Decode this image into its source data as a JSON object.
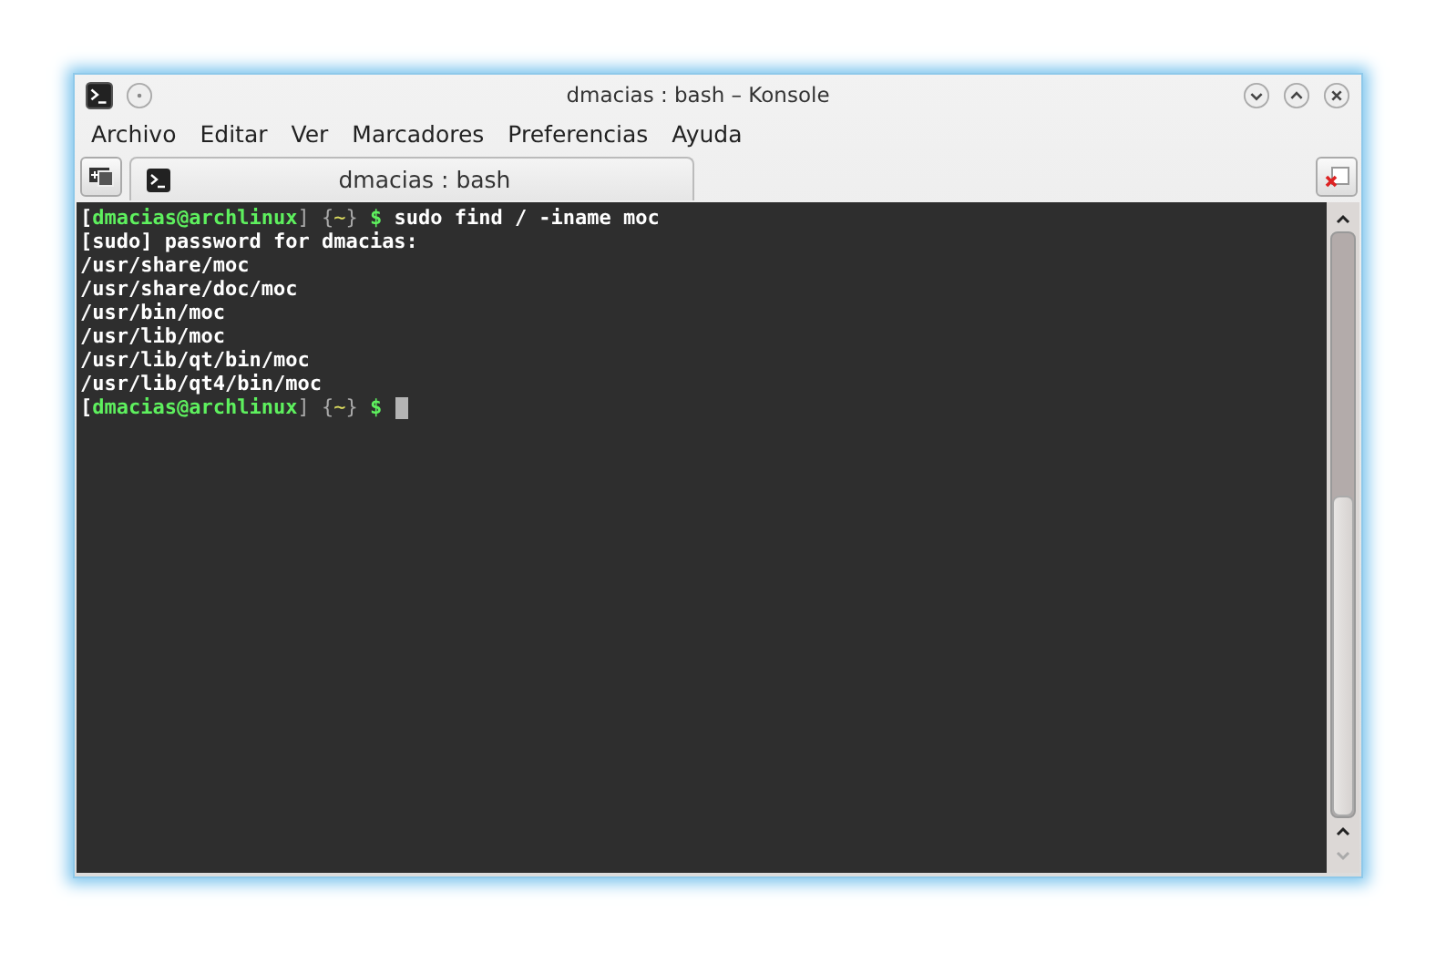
{
  "window": {
    "title": "dmacias : bash – Konsole"
  },
  "menu": [
    "Archivo",
    "Editar",
    "Ver",
    "Marcadores",
    "Preferencias",
    "Ayuda"
  ],
  "tabs": [
    {
      "label": "dmacias : bash",
      "selected": true
    }
  ],
  "terminal": {
    "lines": [
      {
        "segments": [
          {
            "kind": "bracket",
            "text": "["
          },
          {
            "kind": "user",
            "text": "dmacias@archlinux"
          },
          {
            "kind": "dim",
            "text": "]"
          },
          {
            "kind": "dim",
            "text": " {"
          },
          {
            "kind": "dir",
            "text": "~"
          },
          {
            "kind": "dim",
            "text": "}"
          },
          {
            "kind": "sigil",
            "text": " $"
          },
          {
            "kind": "text",
            "text": " sudo find / -iname moc"
          }
        ]
      },
      {
        "segments": [
          {
            "kind": "text",
            "text": "[sudo] password for dmacias:"
          }
        ]
      },
      {
        "segments": [
          {
            "kind": "text",
            "text": "/usr/share/moc"
          }
        ]
      },
      {
        "segments": [
          {
            "kind": "text",
            "text": "/usr/share/doc/moc"
          }
        ]
      },
      {
        "segments": [
          {
            "kind": "text",
            "text": "/usr/bin/moc"
          }
        ]
      },
      {
        "segments": [
          {
            "kind": "text",
            "text": "/usr/lib/moc"
          }
        ]
      },
      {
        "segments": [
          {
            "kind": "text",
            "text": "/usr/lib/qt/bin/moc"
          }
        ]
      },
      {
        "segments": [
          {
            "kind": "text",
            "text": "/usr/lib/qt4/bin/moc"
          }
        ]
      },
      {
        "cursor": true,
        "segments": [
          {
            "kind": "bracket",
            "text": "["
          },
          {
            "kind": "user",
            "text": "dmacias@archlinux"
          },
          {
            "kind": "dim",
            "text": "]"
          },
          {
            "kind": "dim",
            "text": " {"
          },
          {
            "kind": "dir",
            "text": "~"
          },
          {
            "kind": "dim",
            "text": "}"
          },
          {
            "kind": "sigil",
            "text": " $"
          }
        ]
      }
    ]
  }
}
